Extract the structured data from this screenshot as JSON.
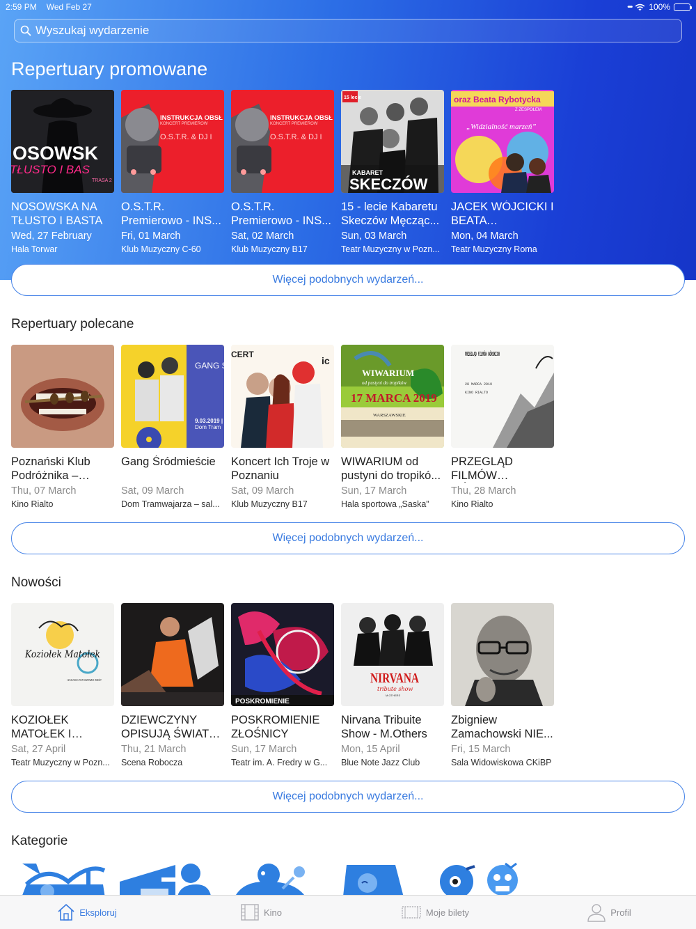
{
  "status": {
    "time": "2:59 PM",
    "date": "Wed Feb 27",
    "battery": "100%"
  },
  "search": {
    "placeholder": "Wyszukaj wydarzenie"
  },
  "promoted": {
    "title": "Repertuary promowane",
    "more_label": "Więcej podobnych wydarzeń...",
    "items": [
      {
        "title": "NOSOWSKA NA TŁUSTO I BASTA",
        "date": "Wed, 27 February",
        "venue": "Hala Torwar",
        "art_text": "OSOWSK",
        "art_sub": "TŁUSTO I BAS",
        "art_tag": "TRASA 2"
      },
      {
        "title": "O.S.T.R. Premierowo - INS...",
        "date": "Fri, 01 March",
        "venue": "Klub Muzyczny C-60",
        "art_text": "INSTRUKCJA OBSŁ",
        "art_sub": "KONCERT PREMIEROW",
        "art_tag": "O.S.T.R. & DJ I"
      },
      {
        "title": "O.S.T.R. Premierowo - INS...",
        "date": "Sat, 02 March",
        "venue": "Klub Muzyczny B17",
        "art_text": "INSTRUKCJA OBSŁ",
        "art_sub": "KONCERT PREMIEROW",
        "art_tag": "O.S.T.R. & DJ I"
      },
      {
        "title": "15 - lecie Kabaretu Skeczów Męcząc...",
        "date": "Sun, 03 March",
        "venue": "Teatr Muzyczny w Pozn...",
        "art_text": "SKECZÓW",
        "art_sub": "KABARET",
        "art_tag": "15 lecie"
      },
      {
        "title": "JACEK WÓJCICKI I BEATA RYBOTYC...",
        "date": "Mon, 04 March",
        "venue": "Teatr Muzyczny Roma",
        "art_text": "oraz Beata Rybotycka",
        "art_sub": "Z ZESPOŁEM",
        "art_tag": "„Widzialność marzeń”"
      }
    ]
  },
  "recommended": {
    "title": "Repertuary polecane",
    "more_label": "Więcej podobnych wydarzeń...",
    "items": [
      {
        "title": "Poznański Klub Podróżnika – Chin...",
        "date": "Thu, 07 March",
        "venue": "Kino Rialto"
      },
      {
        "title": "Gang Śródmieście",
        "date": "Sat, 09 March",
        "venue": "Dom Tramwajarza – sal...",
        "art_text": "GANG ŚRÓDM",
        "art_sub": "9.03.2019 |",
        "art_tag": "Dom Tram"
      },
      {
        "title": " Koncert Ich Troje w Poznaniu",
        "date": "Sat, 09 March",
        "venue": "Klub Muzyczny B17",
        "art_text": "CERT",
        "art_tag": "ic"
      },
      {
        "title": "WIWARIUM od pustyni do tropikó...",
        "date": "Sun, 17 March",
        "venue": "Hala sportowa „Saska”",
        "art_text": "WIWARIUM",
        "art_sub": "od pustyni do tropików",
        "art_tag": "17 MARCA 2019",
        "art_extra": "WARSZAWSKIE"
      },
      {
        "title": "PRZEGLĄD FILMÓW GÓRSKI...",
        "date": "Thu, 28 March",
        "venue": "Kino Rialto",
        "art_text": "PRZEGLĄD FILMÓW GÓRSKICH",
        "art_sub": "28 MARCA 2019",
        "art_tag": "KINO RIALTO"
      }
    ]
  },
  "new_items": {
    "title": "Nowości",
    "more_label": "Więcej podobnych wydarzeń...",
    "items": [
      {
        "title": "KOZIOŁEK MATOŁEK I ZAGA...",
        "date": "Sat, 27 April",
        "venue": "Teatr Muzyczny w Pozn...",
        "art_text": "Koziołek Matołek",
        "art_sub": "I ZAGADKA RATUSZOWEJ WIEŻY"
      },
      {
        "title": "DZIEWCZYNY OPISUJĄ ŚWIAT /...",
        "date": "Thu, 21 March",
        "venue": "Scena Robocza"
      },
      {
        "title": "POSKROMIENIE ZŁOŚNICY",
        "date": "Sun, 17 March",
        "venue": "Teatr im. A. Fredry w G...",
        "art_text": "POSKROMIENIE"
      },
      {
        "title": "Nirvana Tribuite Show - M.Others",
        "date": "Mon, 15 April",
        "venue": "Blue Note Jazz Club",
        "art_text": "NIRVANA",
        "art_sub": "tribute show",
        "art_tag": "M.OTHERS"
      },
      {
        "title": " Zbigniew Zamachowski NIE...",
        "date": "Fri, 15 March",
        "venue": "Sala Widowiskowa CKiBP"
      }
    ]
  },
  "categories": {
    "title": "Kategorie"
  },
  "tabbar": {
    "tabs": [
      {
        "label": "Eksploruj",
        "icon": "home-icon"
      },
      {
        "label": "Kino",
        "icon": "film-icon"
      },
      {
        "label": "Moje bilety",
        "icon": "ticket-icon"
      },
      {
        "label": "Profil",
        "icon": "person-icon"
      }
    ]
  },
  "colors": {
    "accent": "#3a7be0",
    "hero_start": "#5aa4f6",
    "hero_end": "#1635c8"
  }
}
